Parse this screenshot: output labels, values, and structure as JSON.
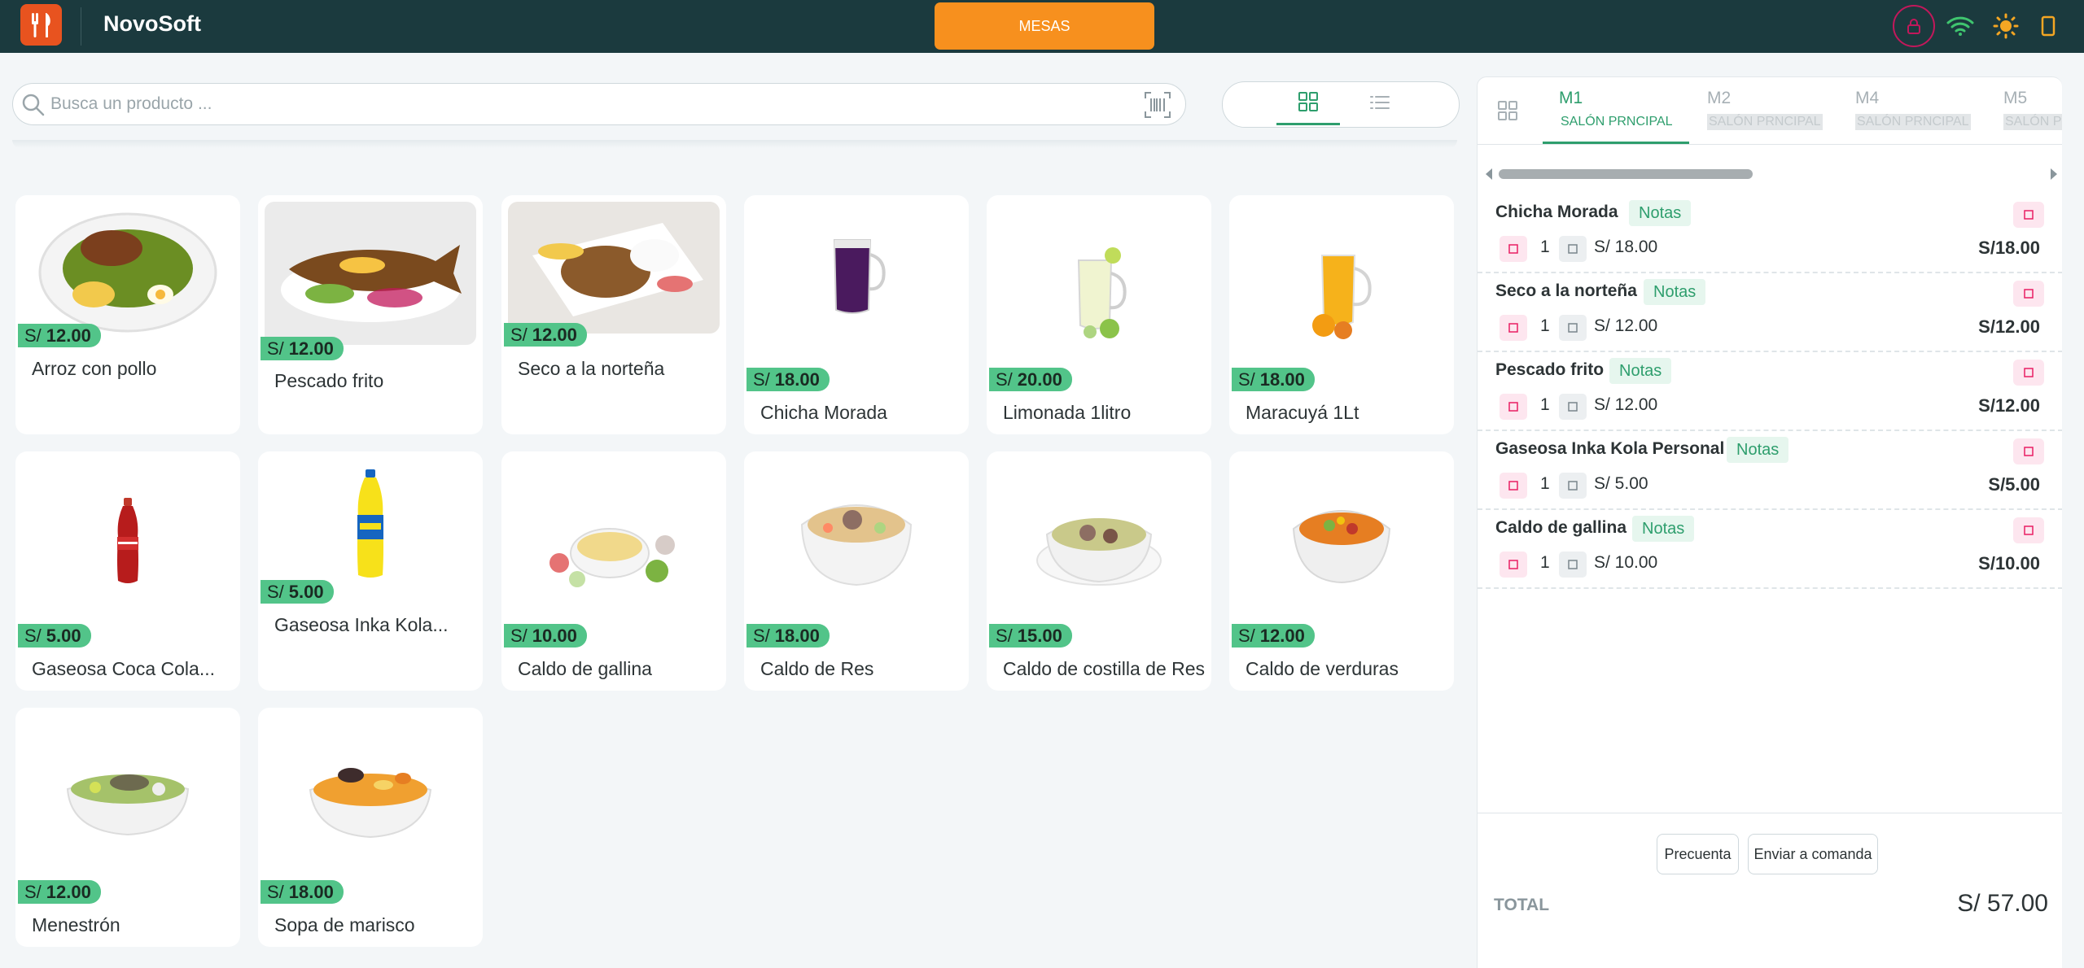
{
  "app": {
    "brand": "NovoSoft",
    "mesas_label": "MESAS"
  },
  "search": {
    "placeholder": "Busca un producto ...",
    "value": ""
  },
  "products": [
    {
      "name": "Arroz con pollo",
      "currency": "S/",
      "price": "12.00",
      "icon": "arroz-con-pollo-image"
    },
    {
      "name": "Pescado frito",
      "currency": "S/",
      "price": "12.00",
      "icon": "pescado-frito-image"
    },
    {
      "name": "Seco a la norteña",
      "currency": "S/",
      "price": "12.00",
      "icon": "seco-norteña-image"
    },
    {
      "name": "Chicha Morada",
      "currency": "S/",
      "price": "18.00",
      "icon": "chicha-morada-image"
    },
    {
      "name": "Limonada 1litro",
      "currency": "S/",
      "price": "20.00",
      "icon": "limonada-image"
    },
    {
      "name": "Maracuyá 1Lt",
      "currency": "S/",
      "price": "18.00",
      "icon": "maracuya-image"
    },
    {
      "name": "Gaseosa Coca Cola...",
      "currency": "S/",
      "price": "5.00",
      "icon": "coca-cola-image"
    },
    {
      "name": "Gaseosa Inka Kola...",
      "currency": "S/",
      "price": "5.00",
      "icon": "inka-kola-image"
    },
    {
      "name": "Caldo de gallina",
      "currency": "S/",
      "price": "10.00",
      "icon": "caldo-gallina-image"
    },
    {
      "name": "Caldo de Res",
      "currency": "S/",
      "price": "18.00",
      "icon": "caldo-res-image"
    },
    {
      "name": "Caldo de costilla de Res",
      "currency": "S/",
      "price": "15.00",
      "icon": "caldo-costilla-image"
    },
    {
      "name": "Caldo de verduras",
      "currency": "S/",
      "price": "12.00",
      "icon": "caldo-verduras-image"
    },
    {
      "name": "Menestrón",
      "currency": "S/",
      "price": "12.00",
      "icon": "menestron-image"
    },
    {
      "name": "Sopa de marisco",
      "currency": "S/",
      "price": "18.00",
      "icon": "sopa-marisco-image"
    }
  ],
  "tables": [
    {
      "label": "M1",
      "zone": "SALÓN PRNCIPAL",
      "active": true
    },
    {
      "label": "M2",
      "zone": "SALÓN PRNCIPAL",
      "active": false
    },
    {
      "label": "M4",
      "zone": "SALÓN PRNCIPAL",
      "active": false
    },
    {
      "label": "M5",
      "zone": "SALÓN PRNCIPAL",
      "active": false
    }
  ],
  "order_items": [
    {
      "name": "Chicha Morada",
      "notes_label": "Notas",
      "qty": "1",
      "unit_price": "S/ 18.00",
      "subtotal": "S/18.00"
    },
    {
      "name": "Seco a la norteña",
      "notes_label": "Notas",
      "qty": "1",
      "unit_price": "S/ 12.00",
      "subtotal": "S/12.00"
    },
    {
      "name": "Pescado frito",
      "notes_label": "Notas",
      "qty": "1",
      "unit_price": "S/ 12.00",
      "subtotal": "S/12.00"
    },
    {
      "name": "Gaseosa Inka Kola Personal",
      "notes_label": "Notas",
      "qty": "1",
      "unit_price": "S/ 5.00",
      "subtotal": "S/5.00"
    },
    {
      "name": "Caldo de gallina",
      "notes_label": "Notas",
      "qty": "1",
      "unit_price": "S/ 10.00",
      "subtotal": "S/10.00"
    }
  ],
  "footer": {
    "precuenta_label": "Precuenta",
    "enviar_label": "Enviar a comanda",
    "total_label": "TOTAL",
    "total_value": "S/ 57.00"
  },
  "colors": {
    "topbar": "#1b3a3e",
    "accent_orange": "#f7901e",
    "accent_green": "#2e9e6d",
    "price_badge": "#52c489",
    "danger_pink": "#c2185b"
  },
  "icons": {
    "logo": "restaurant-utensils-icon",
    "lock": "lock-icon",
    "wifi": "wifi-icon",
    "theme": "sun-icon",
    "device": "phone-icon",
    "search": "search-icon",
    "barcode": "barcode-scan-icon",
    "grid_view": "grid-icon",
    "list_view": "list-icon",
    "tables": "tables-grid-icon",
    "delete": "trash-icon",
    "minus": "minus-icon",
    "plus": "plus-icon"
  }
}
